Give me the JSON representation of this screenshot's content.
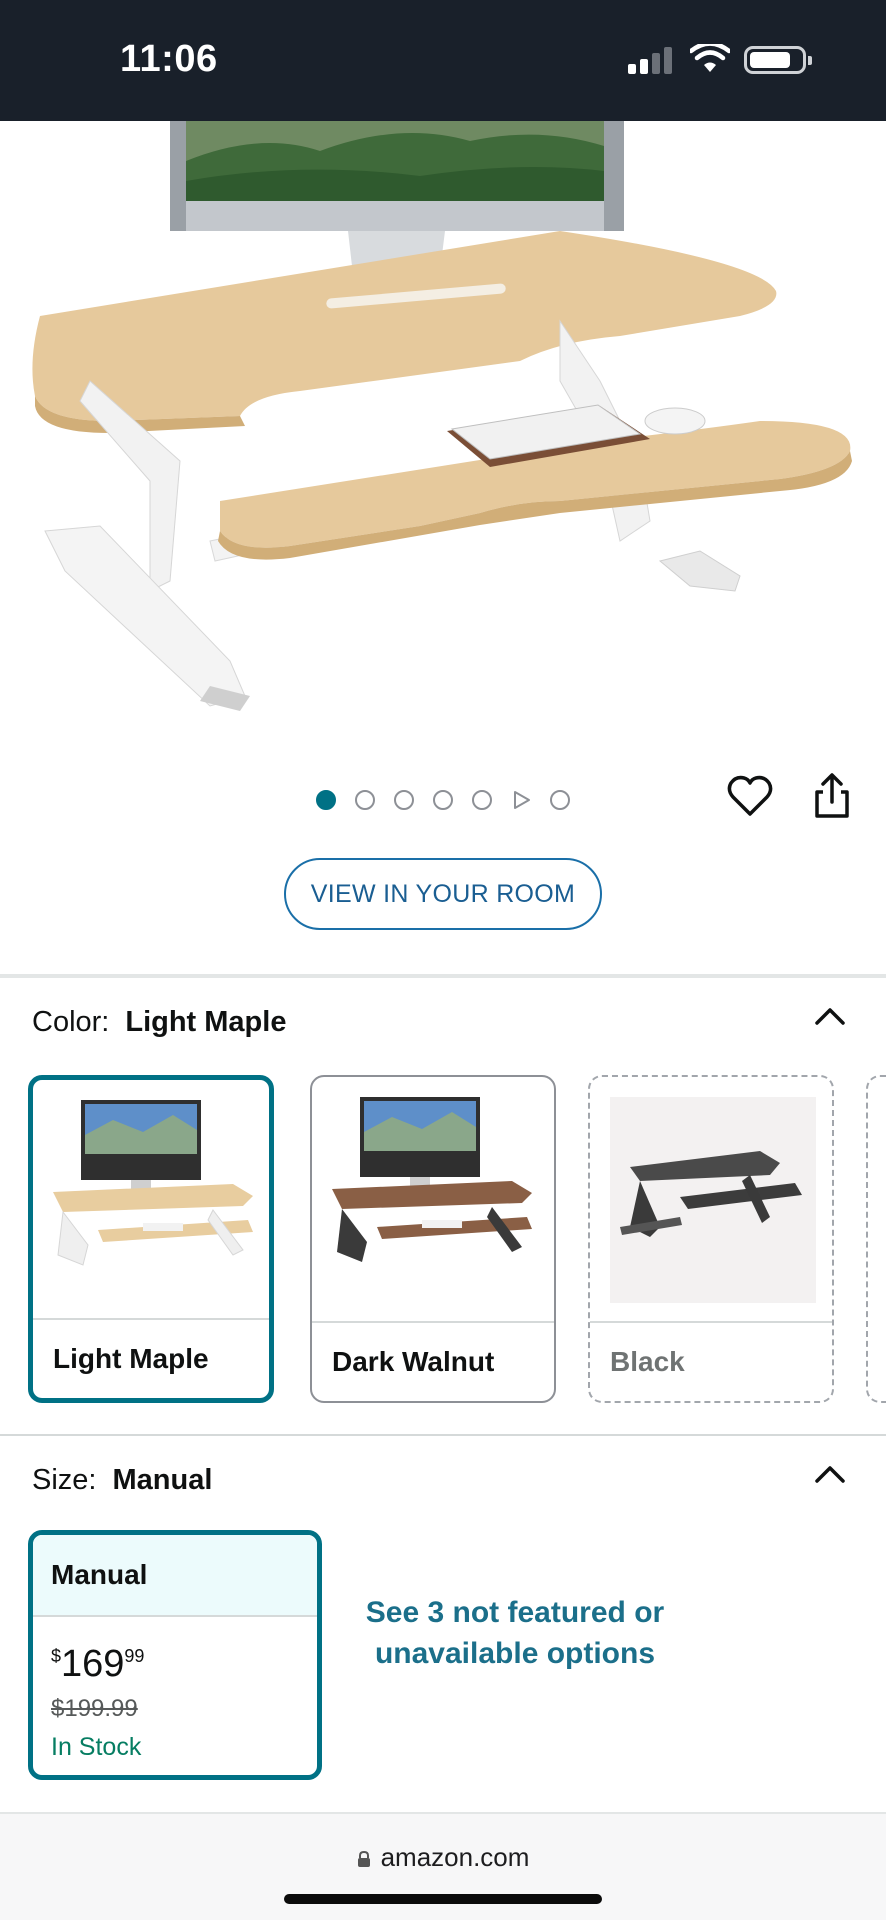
{
  "status_bar": {
    "time": "11:06",
    "icons": [
      "signal-icon",
      "wifi-icon",
      "battery-icon"
    ]
  },
  "gallery": {
    "image_description": "Light maple standing desk converter with monitor and keyboard",
    "dots_count": 7,
    "active_index": 0,
    "video_index": 5,
    "favorite_icon": "heart-icon",
    "share_icon": "share-icon",
    "view_in_room_label": "VIEW IN YOUR ROOM"
  },
  "color": {
    "label": "Color:",
    "selected": "Light Maple",
    "options": [
      {
        "name": "Light Maple",
        "state": "selected"
      },
      {
        "name": "Dark Walnut",
        "state": "available"
      },
      {
        "name": "Black",
        "state": "unavailable"
      }
    ]
  },
  "size": {
    "label": "Size:",
    "selected": "Manual",
    "card": {
      "title": "Manual",
      "currency": "$",
      "price_whole": "169",
      "price_fraction": "99",
      "list_price": "$199.99",
      "availability": "In Stock"
    },
    "more_options": "See 3 not featured or unavailable options"
  },
  "browser": {
    "url": "amazon.com"
  },
  "colors": {
    "accent": "#007185",
    "status_bar_bg": "#19202a",
    "in_stock": "#067d62",
    "link": "#1b6f8a"
  }
}
